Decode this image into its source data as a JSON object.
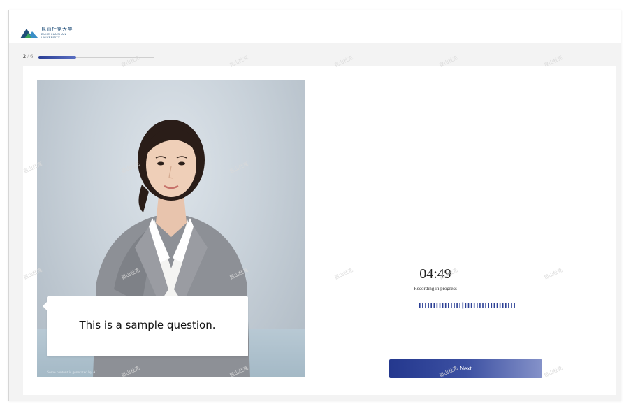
{
  "header": {
    "logo_cn": "昆山杜克大学",
    "logo_en_1": "DUKE KUNSHAN",
    "logo_en_2": "UNIVERSITY"
  },
  "progress": {
    "current": "2",
    "total": "/ 6",
    "fraction": 0.33
  },
  "question": {
    "text": "This is a sample question.",
    "ai_notice": "Some content is generated by AI"
  },
  "recording": {
    "timer": "04:49",
    "status": "Recording in progress"
  },
  "actions": {
    "next_label": "Next"
  },
  "watermark": "昆山杜克",
  "colors": {
    "accent": "#2b3f95",
    "accent_light": "#8592c9",
    "background": "#f3f3f3"
  }
}
